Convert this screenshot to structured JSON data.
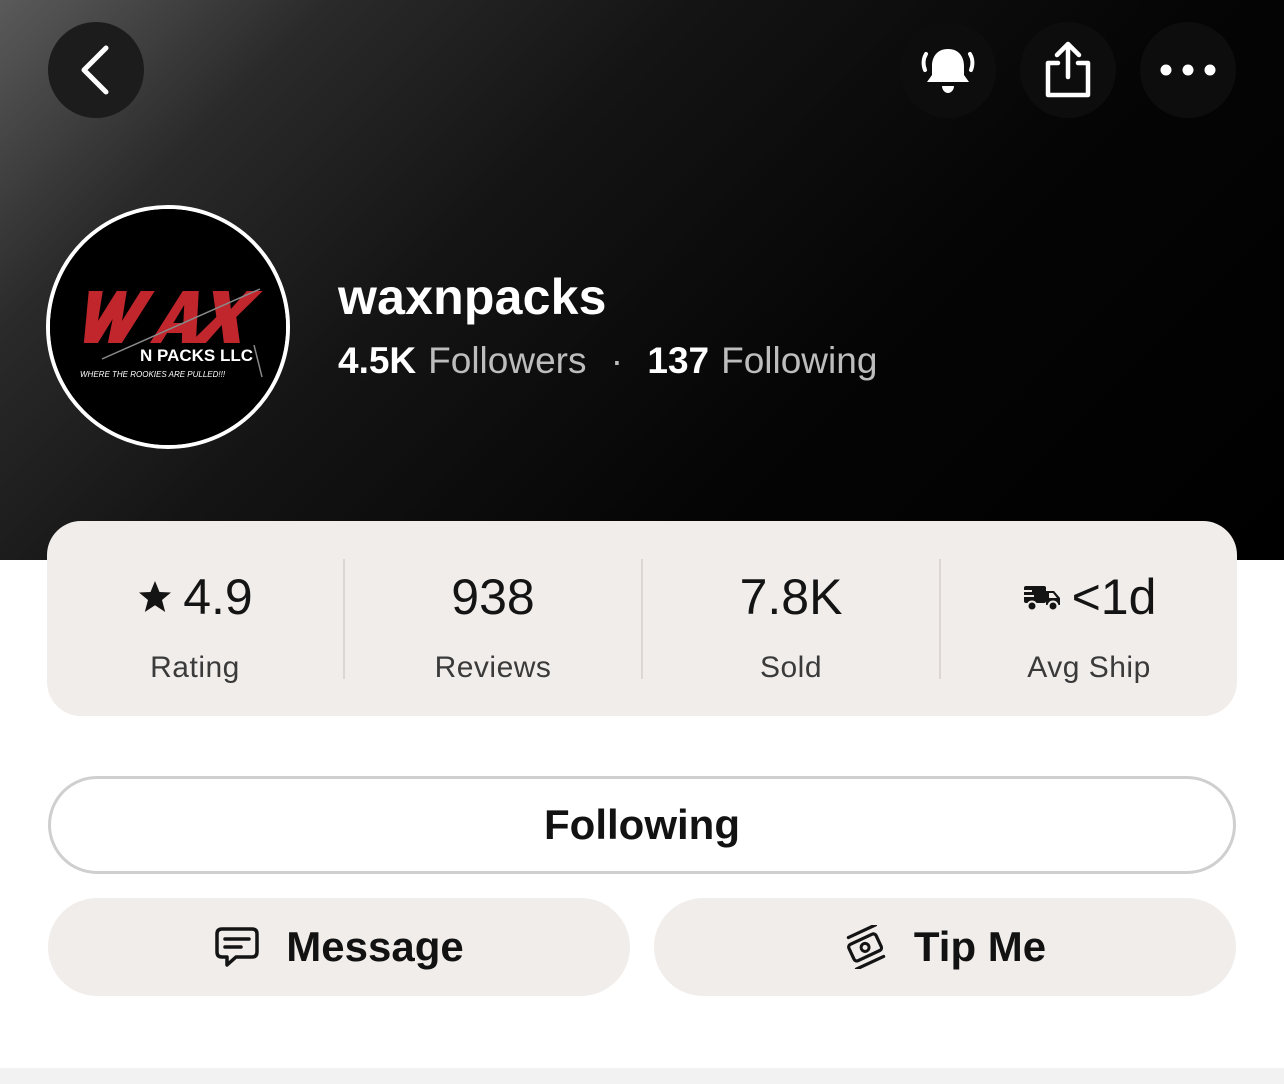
{
  "header": {
    "buttons": {
      "back_icon": "chevron-left-icon",
      "bell_icon": "bell-ringing-icon",
      "share_icon": "share-icon",
      "more_icon": "ellipsis-icon"
    }
  },
  "profile": {
    "username": "waxnpacks",
    "followers_count": "4.5K",
    "followers_label": "Followers",
    "separator": "·",
    "following_count": "137",
    "following_label": "Following",
    "avatar_logo": {
      "brand": "WAX",
      "line2": "N PACKS LLC",
      "tagline": "WHERE THE ROOKIES ARE PULLED!!!"
    }
  },
  "stats": [
    {
      "icon": "star-icon",
      "value": "4.9",
      "label": "Rating"
    },
    {
      "icon": "",
      "value": "938",
      "label": "Reviews"
    },
    {
      "icon": "",
      "value": "7.8K",
      "label": "Sold"
    },
    {
      "icon": "delivery-truck-icon",
      "value": "<1d",
      "label": "Avg Ship"
    }
  ],
  "actions": {
    "follow_label": "Following",
    "message_label": "Message",
    "message_icon": "chat-bubble-icon",
    "tip_label": "Tip Me",
    "tip_icon": "money-stack-icon"
  },
  "colors": {
    "header_bg": "#000000",
    "card_bg": "#f1edeb",
    "logo_red": "#c0262c"
  }
}
